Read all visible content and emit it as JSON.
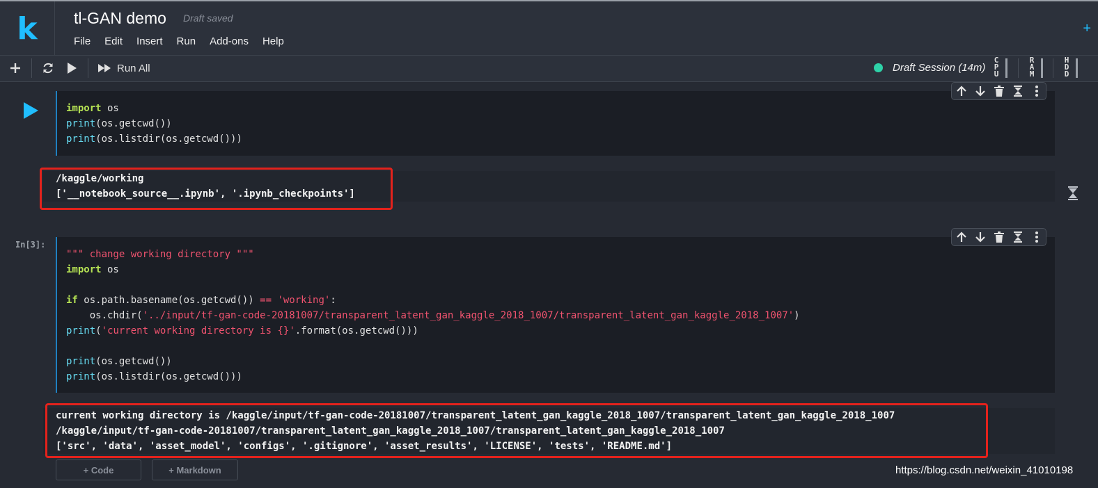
{
  "app": {
    "logo": "k",
    "title": "tl-GAN demo",
    "draft_status": "Draft saved"
  },
  "menu": [
    "File",
    "Edit",
    "Insert",
    "Run",
    "Add-ons",
    "Help"
  ],
  "toolbar": {
    "run_all_label": "Run All",
    "session_label": "Draft Session (14m)",
    "session_color": "#2ed2a8",
    "meters": [
      "CPU",
      "RAM",
      "HDD"
    ]
  },
  "cells": [
    {
      "exec_label": "",
      "code": [
        [
          {
            "t": "import",
            "c": "kw"
          },
          {
            "t": " os",
            "c": ""
          }
        ],
        [
          {
            "t": "print",
            "c": "bi"
          },
          {
            "t": "(os.getcwd())",
            "c": ""
          }
        ],
        [
          {
            "t": "print",
            "c": "bi"
          },
          {
            "t": "(os.listdir(os.getcwd()))",
            "c": ""
          }
        ]
      ],
      "output": [
        "/kaggle/working",
        "['__notebook_source__.ipynb', '.ipynb_checkpoints']"
      ]
    },
    {
      "exec_label": "In[3]:",
      "code": [
        [
          {
            "t": "\"\"\" change working directory \"\"\"",
            "c": "str"
          }
        ],
        [
          {
            "t": "import",
            "c": "kw"
          },
          {
            "t": " os",
            "c": ""
          }
        ],
        [
          {
            "t": "",
            "c": ""
          }
        ],
        [
          {
            "t": "if",
            "c": "kw"
          },
          {
            "t": " os.path.basename(os.getcwd()) ",
            "c": ""
          },
          {
            "t": "==",
            "c": "op"
          },
          {
            "t": " ",
            "c": ""
          },
          {
            "t": "'working'",
            "c": "str"
          },
          {
            "t": ":",
            "c": ""
          }
        ],
        [
          {
            "t": "    os.chdir(",
            "c": ""
          },
          {
            "t": "'../input/tf-gan-code-20181007/transparent_latent_gan_kaggle_2018_1007/transparent_latent_gan_kaggle_2018_1007'",
            "c": "str"
          },
          {
            "t": ")",
            "c": ""
          }
        ],
        [
          {
            "t": "print",
            "c": "bi"
          },
          {
            "t": "(",
            "c": ""
          },
          {
            "t": "'current working directory is {}'",
            "c": "str"
          },
          {
            "t": ".format(os.getcwd()))",
            "c": ""
          }
        ],
        [
          {
            "t": "",
            "c": ""
          }
        ],
        [
          {
            "t": "print",
            "c": "bi"
          },
          {
            "t": "(os.getcwd())",
            "c": ""
          }
        ],
        [
          {
            "t": "print",
            "c": "bi"
          },
          {
            "t": "(os.listdir(os.getcwd()))",
            "c": ""
          }
        ]
      ],
      "output": [
        "current working directory is /kaggle/input/tf-gan-code-20181007/transparent_latent_gan_kaggle_2018_1007/transparent_latent_gan_kaggle_2018_1007",
        "/kaggle/input/tf-gan-code-20181007/transparent_latent_gan_kaggle_2018_1007/transparent_latent_gan_kaggle_2018_1007",
        "['src', 'data', 'asset_model', 'configs', '.gitignore', 'asset_results', 'LICENSE', 'tests', 'README.md']"
      ]
    }
  ],
  "add_buttons": {
    "code": "+ Code",
    "markdown": "+ Markdown"
  },
  "watermark": "https://blog.csdn.net/weixin_41010198",
  "colors": {
    "accent": "#20beff",
    "highlight_box": "#e3221c",
    "cell_border": "#1f7fc0"
  }
}
